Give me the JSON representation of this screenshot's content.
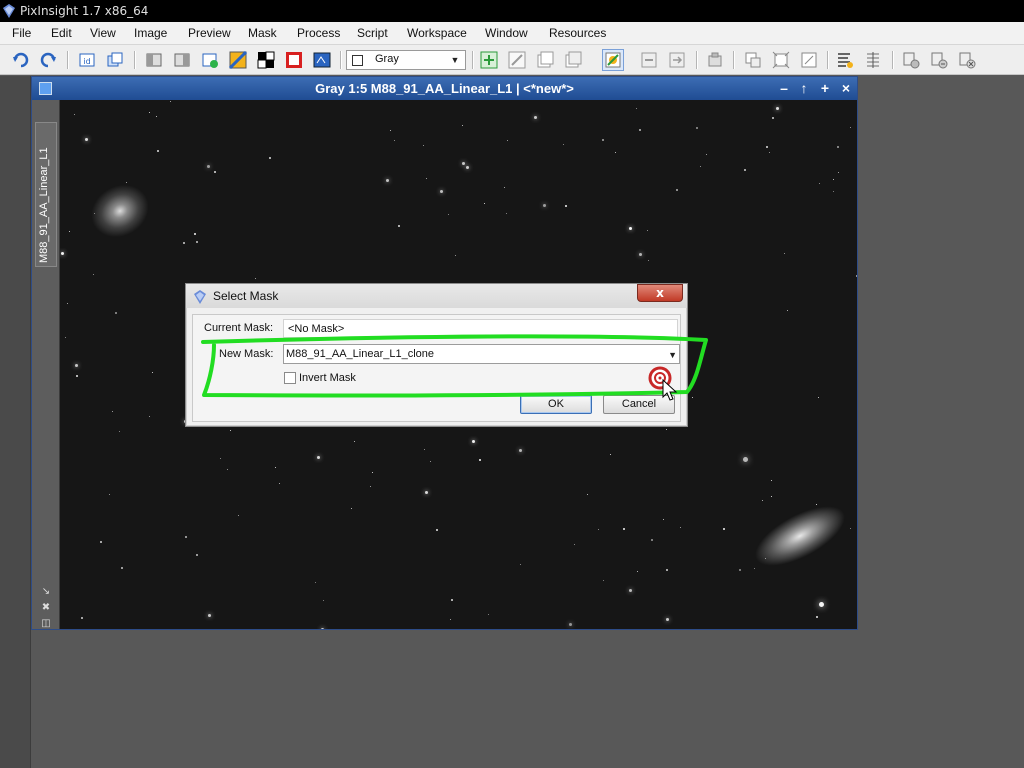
{
  "app": {
    "title": "PixInsight 1.7 x86_64"
  },
  "menubar": {
    "items": [
      "File",
      "Edit",
      "View",
      "Image",
      "Preview",
      "Mask",
      "Process",
      "Script",
      "Workspace",
      "Window",
      "Resources"
    ]
  },
  "toolbar": {
    "channel_select": "Gray"
  },
  "image_window": {
    "title": "Gray 1:5 M88_91_AA_Linear_L1 | <*new*>",
    "side_tab_label": "M88_91_AA_Linear_L1",
    "controls": [
      "–",
      "↑",
      "+",
      "×"
    ]
  },
  "dialog": {
    "title": "Select Mask",
    "close_label": "x",
    "current_mask_label": "Current Mask:",
    "current_mask_value": "<No Mask>",
    "new_mask_label": "New Mask:",
    "new_mask_value": "M88_91_AA_Linear_L1_clone",
    "invert_mask_label": "Invert Mask",
    "invert_mask_checked": false,
    "ok_label": "OK",
    "cancel_label": "Cancel"
  },
  "colors": {
    "annotation": "#22dd22",
    "window_title": "#2a5aa3",
    "close_button": "#c84a36"
  }
}
